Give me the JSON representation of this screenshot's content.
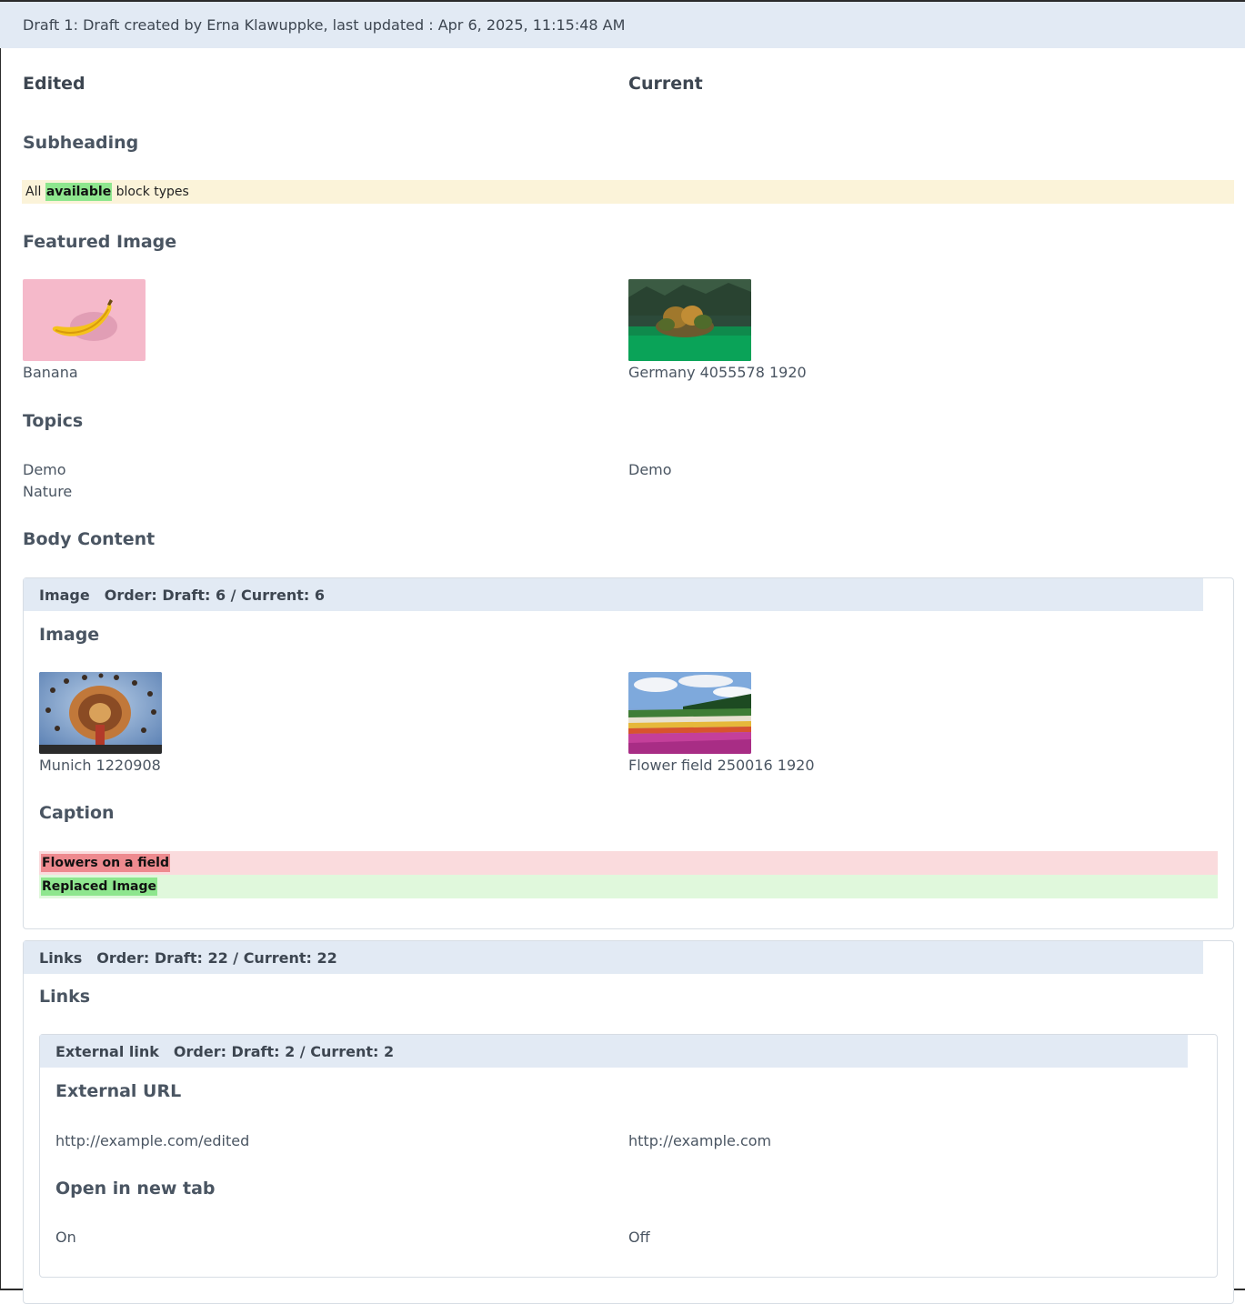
{
  "header": {
    "text": "Draft 1: Draft created by Erna Klawuppke, last updated : Apr 6, 2025, 11:15:48 AM"
  },
  "columns": {
    "edited": "Edited",
    "current": "Current"
  },
  "subheading": {
    "title": "Subheading",
    "before": "All ",
    "added": "available",
    "after": " block types"
  },
  "featured_image": {
    "title": "Featured Image",
    "edited_caption": "Banana",
    "current_caption": "Germany 4055578 1920",
    "edited_icon": "banana-image",
    "current_icon": "lake-island-image"
  },
  "topics": {
    "title": "Topics",
    "edited": [
      "Demo",
      "Nature"
    ],
    "current": [
      "Demo"
    ]
  },
  "body_content": {
    "title": "Body Content",
    "image_block": {
      "type": "Image",
      "order": "Order: Draft: 6 / Current: 6",
      "image_title": "Image",
      "edited_caption": "Munich 1220908",
      "current_caption": "Flower field 250016 1920",
      "caption_title": "Caption",
      "caption_removed": "Flowers on a field",
      "caption_added": "Replaced Image"
    },
    "links_block": {
      "type": "Links",
      "order": "Order: Draft: 22 / Current: 22",
      "links_title": "Links",
      "external_link": {
        "type": "External link",
        "order": "Order: Draft: 2 / Current: 2",
        "url_title": "External URL",
        "url_edited": "http://example.com/edited",
        "url_current": "http://example.com",
        "new_tab_title": "Open in new tab",
        "new_tab_edited": "On",
        "new_tab_current": "Off"
      }
    }
  },
  "colors": {
    "header_bg": "#e2eaf4",
    "added_highlight": "#8ee68e",
    "removed_highlight": "#ee8a8f",
    "changed_row_bg": "#fbf3d9"
  }
}
